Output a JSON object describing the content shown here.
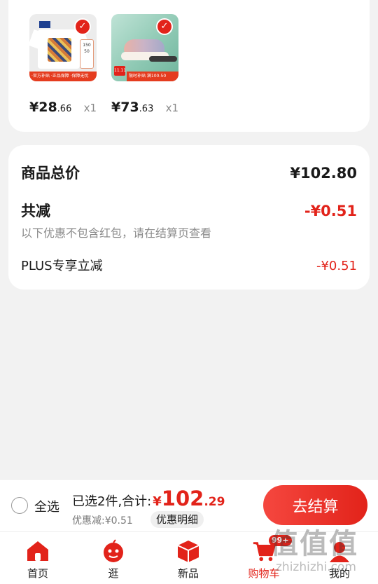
{
  "products": [
    {
      "name": "tshirt",
      "price_int": "¥28",
      "price_dec": ".66",
      "qty": "x1",
      "promo": "·官方补贴 ·正品保障 ·保障无忧",
      "size_tag": "150 50"
    },
    {
      "name": "sneaker",
      "price_int": "¥73",
      "price_dec": ".63",
      "qty": "x1",
      "promo": "限时补贴 满100-50",
      "badge": "11.11"
    }
  ],
  "summary": {
    "total_label": "商品总价",
    "total_value": "¥102.80",
    "discount_label": "共减",
    "discount_value": "-¥0.51",
    "discount_note": "以下优惠不包含红包，请在结算页查看",
    "plus_label": "PLUS专享立减",
    "plus_value": "-¥0.51"
  },
  "checkout": {
    "select_all": "全选",
    "selected_text": "已选2件,合计:",
    "currency": "¥",
    "grand_int": "102",
    "grand_dec": ".29",
    "saved_text": "优惠减:¥0.51",
    "detail_label": "优惠明细",
    "checkout_label": "去结算"
  },
  "tabs": [
    {
      "label": "首页"
    },
    {
      "label": "逛"
    },
    {
      "label": "新品"
    },
    {
      "label": "购物车",
      "badge": "99+"
    },
    {
      "label": "我的"
    }
  ],
  "colors": {
    "accent": "#e2231a",
    "background": "#f2f2f2"
  },
  "watermark": {
    "glyphs": "值值值",
    "domain": "zhizhizhi.com"
  }
}
